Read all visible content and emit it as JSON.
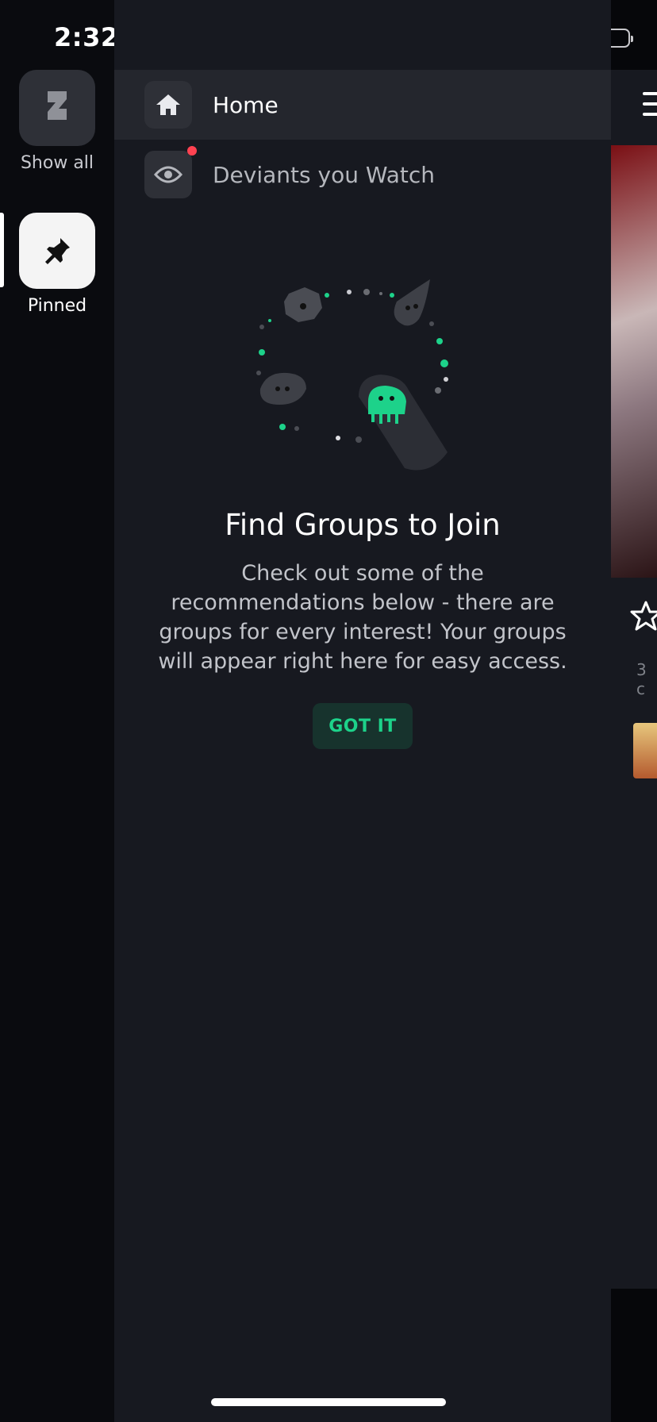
{
  "status_bar": {
    "time": "2:32"
  },
  "rail": {
    "items": [
      {
        "label": "Show all",
        "icon": "deviantart-logo-icon",
        "selected": false
      },
      {
        "label": "Pinned",
        "icon": "pin-icon",
        "selected": true
      }
    ]
  },
  "drawer": {
    "nav": [
      {
        "label": "Home",
        "icon": "home-icon",
        "active": true
      },
      {
        "label": "Deviants you Watch",
        "icon": "eye-icon",
        "active": false,
        "notification": true
      }
    ],
    "empty_state": {
      "title": "Find Groups to Join",
      "body": "Check out some of the recommendations below - there are groups for every interest! Your groups will appear right here for easy access.",
      "button_label": "GOT IT"
    }
  },
  "background": {
    "partial_text": "3 c"
  },
  "colors": {
    "accent": "#1dd28a",
    "notification": "#ff4251",
    "drawer_bg": "#171920",
    "rail_bg": "#0a0b0f"
  }
}
